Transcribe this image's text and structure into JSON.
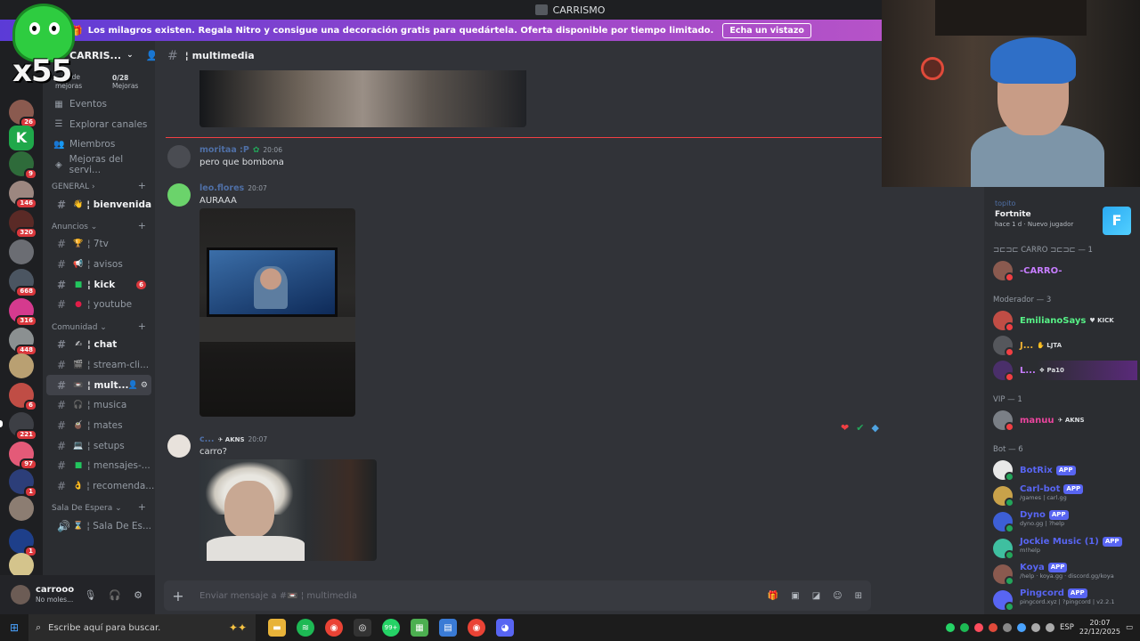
{
  "window": {
    "title": "CARRISMO"
  },
  "banner": {
    "text": "Los milagros existen. Regala Nitro y consigue una decoración gratis para quedártela. Oferta disponible por tiempo limitado.",
    "cta": "Echa un vistazo"
  },
  "overlay": {
    "counter": "x55"
  },
  "servers": {
    "badges": [
      "26",
      "9",
      "146",
      "320",
      "668",
      "316",
      "448",
      "6",
      "221",
      "97",
      "1",
      "1"
    ]
  },
  "sidebar": {
    "server_name": "CARRIS...",
    "boost": {
      "left_label": "...vo de mejoras",
      "right_value": "0/28",
      "right_label": "Mejoras"
    },
    "nav": [
      "Eventos",
      "Explorar canales",
      "Miembros",
      "Mejoras del servi..."
    ],
    "categories": {
      "general": "GENERAL",
      "anuncios": "Anuncios",
      "comunidad": "Comunidad",
      "espera": "Sala De Espera"
    },
    "channels": {
      "bienvenida": "¦ bienvenida",
      "sevenTv": "¦ 7tv",
      "avisos": "¦ avisos",
      "kick": "¦ kick",
      "kick_count": "6",
      "youtube": "¦ youtube",
      "chat": "¦ chat",
      "streamclips": "¦ stream-cli...",
      "multimedia": "¦ mult...",
      "musica": "¦ musica",
      "mates": "¦ mates",
      "setups": "¦ setups",
      "mensajes": "¦ mensajes-...",
      "recomendaciones": "¦ recomenda...",
      "salaespera": "¦ Sala De Es..."
    }
  },
  "user": {
    "name": "carrooo",
    "status": "No moles..."
  },
  "chat": {
    "channel_title": "¦ multimedia",
    "messages": [
      {
        "user": "moritaa :P",
        "time": "20:06",
        "text": "pero que bombona",
        "color": "#4f6fa5"
      },
      {
        "user": "leo.flores",
        "time": "20:07",
        "text": "AURAAA",
        "color": "#4f6fa5"
      },
      {
        "user": "c...",
        "tag": "AKNS",
        "time": "20:07",
        "text": "carro?",
        "color": "#4f6fa5"
      }
    ],
    "composer_placeholder": "Enviar mensaje a #📼 ¦ multimedia"
  },
  "members": {
    "activity": {
      "user": "topito",
      "game": "Fortnite",
      "detail": "hace 1 d  ·  Nuevo jugador",
      "icon": "F"
    },
    "groups": {
      "carro": "⊐⊏⊐⊏ CARRO ⊐⊏⊐⊏ — 1",
      "mod": "Moderador — 3",
      "vip": "VIP — 1",
      "bot": "Bot — 6"
    },
    "list": {
      "carro": {
        "name": "-CARRO-",
        "color": "#c77dff"
      },
      "emiliano": {
        "name": "EmilianoSays",
        "tag": "KICK",
        "color": "#57f287"
      },
      "j": {
        "name": "J...",
        "tag": "LJTA",
        "color": "#f0b232"
      },
      "l": {
        "name": "L...",
        "tag": "Pa10",
        "color": "#c77dff"
      },
      "manuu": {
        "name": "manuu",
        "tag": "AKNS",
        "color": "#eb459e"
      },
      "botrix": {
        "name": "BotRix",
        "sub": ""
      },
      "carlbot": {
        "name": "Carl-bot",
        "sub": "/games | carl.gg"
      },
      "dyno": {
        "name": "Dyno",
        "sub": "dyno.gg | ?help"
      },
      "jockie": {
        "name": "Jockie Music (1)",
        "sub": "m!help"
      },
      "koya": {
        "name": "Koya",
        "sub": "/help · koya.gg · discord.gg/koya"
      },
      "pingcord": {
        "name": "Pingcord",
        "sub": "pingcord.xyz | ?pingcord | v2.2.1"
      },
      "app_label": "APP"
    }
  },
  "taskbar": {
    "search_placeholder": "Escribe aquí para buscar.",
    "lang": "ESP",
    "time": "20:07",
    "date": "22/12/2025",
    "notif_badge": "99+"
  }
}
